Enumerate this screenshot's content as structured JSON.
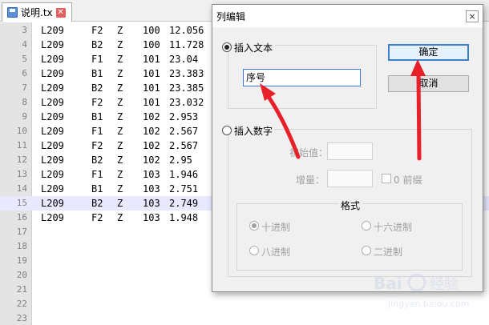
{
  "editor": {
    "tab_label": "说明.tx",
    "lines": [
      {
        "n": "3",
        "c1": "L209",
        "c2": "F2",
        "c3": "Z",
        "c4": "100",
        "c5": "12.056"
      },
      {
        "n": "4",
        "c1": "L209",
        "c2": "B2",
        "c3": "Z",
        "c4": "100",
        "c5": "11.728"
      },
      {
        "n": "5",
        "c1": "L209",
        "c2": "F1",
        "c3": "Z",
        "c4": "101",
        "c5": "23.04"
      },
      {
        "n": "6",
        "c1": "L209",
        "c2": "B1",
        "c3": "Z",
        "c4": "101",
        "c5": "23.383"
      },
      {
        "n": "7",
        "c1": "L209",
        "c2": "B2",
        "c3": "Z",
        "c4": "101",
        "c5": "23.385"
      },
      {
        "n": "8",
        "c1": "L209",
        "c2": "F2",
        "c3": "Z",
        "c4": "101",
        "c5": "23.032"
      },
      {
        "n": "9",
        "c1": "L209",
        "c2": "B1",
        "c3": "Z",
        "c4": "102",
        "c5": "2.953"
      },
      {
        "n": "10",
        "c1": "L209",
        "c2": "F1",
        "c3": "Z",
        "c4": "102",
        "c5": "2.567"
      },
      {
        "n": "11",
        "c1": "L209",
        "c2": "F2",
        "c3": "Z",
        "c4": "102",
        "c5": "2.567"
      },
      {
        "n": "12",
        "c1": "L209",
        "c2": "B2",
        "c3": "Z",
        "c4": "102",
        "c5": "2.95"
      },
      {
        "n": "13",
        "c1": "L209",
        "c2": "F1",
        "c3": "Z",
        "c4": "103",
        "c5": "1.946"
      },
      {
        "n": "14",
        "c1": "L209",
        "c2": "B1",
        "c3": "Z",
        "c4": "103",
        "c5": "2.751"
      },
      {
        "n": "15",
        "c1": "L209",
        "c2": "B2",
        "c3": "Z",
        "c4": "103",
        "c5": "2.749"
      },
      {
        "n": "16",
        "c1": "L209",
        "c2": "F2",
        "c3": "Z",
        "c4": "103",
        "c5": "1.948"
      },
      {
        "n": "17",
        "c1": "",
        "c2": "",
        "c3": "",
        "c4": "",
        "c5": ""
      },
      {
        "n": "18",
        "c1": "",
        "c2": "",
        "c3": "",
        "c4": "",
        "c5": ""
      },
      {
        "n": "19",
        "c1": "",
        "c2": "",
        "c3": "",
        "c4": "",
        "c5": ""
      },
      {
        "n": "20",
        "c1": "",
        "c2": "",
        "c3": "",
        "c4": "",
        "c5": ""
      },
      {
        "n": "21",
        "c1": "",
        "c2": "",
        "c3": "",
        "c4": "",
        "c5": ""
      },
      {
        "n": "22",
        "c1": "",
        "c2": "",
        "c3": "",
        "c4": "",
        "c5": ""
      },
      {
        "n": "23",
        "c1": "",
        "c2": "",
        "c3": "",
        "c4": "",
        "c5": ""
      }
    ],
    "highlighted_line": "15"
  },
  "dialog": {
    "title": "列编辑",
    "close_glyph": "×",
    "insert_text_label": "插入文本",
    "insert_text_value": "序号",
    "insert_number_label": "插入数字",
    "initial_label": "初始值：",
    "initial_value": "",
    "increment_label": "增量：",
    "increment_value": "",
    "leading_zero_label": "0 前缀",
    "format_label": "格式",
    "dec_label": "十进制",
    "hex_label": "十六进制",
    "oct_label": "八进制",
    "bin_label": "二进制",
    "ok_label": "确定",
    "cancel_label": "取消"
  },
  "colors": {
    "arrow": "#e8202a",
    "highlight_line": "#e8e8ff",
    "default_button_border": "#3c7fd1"
  }
}
